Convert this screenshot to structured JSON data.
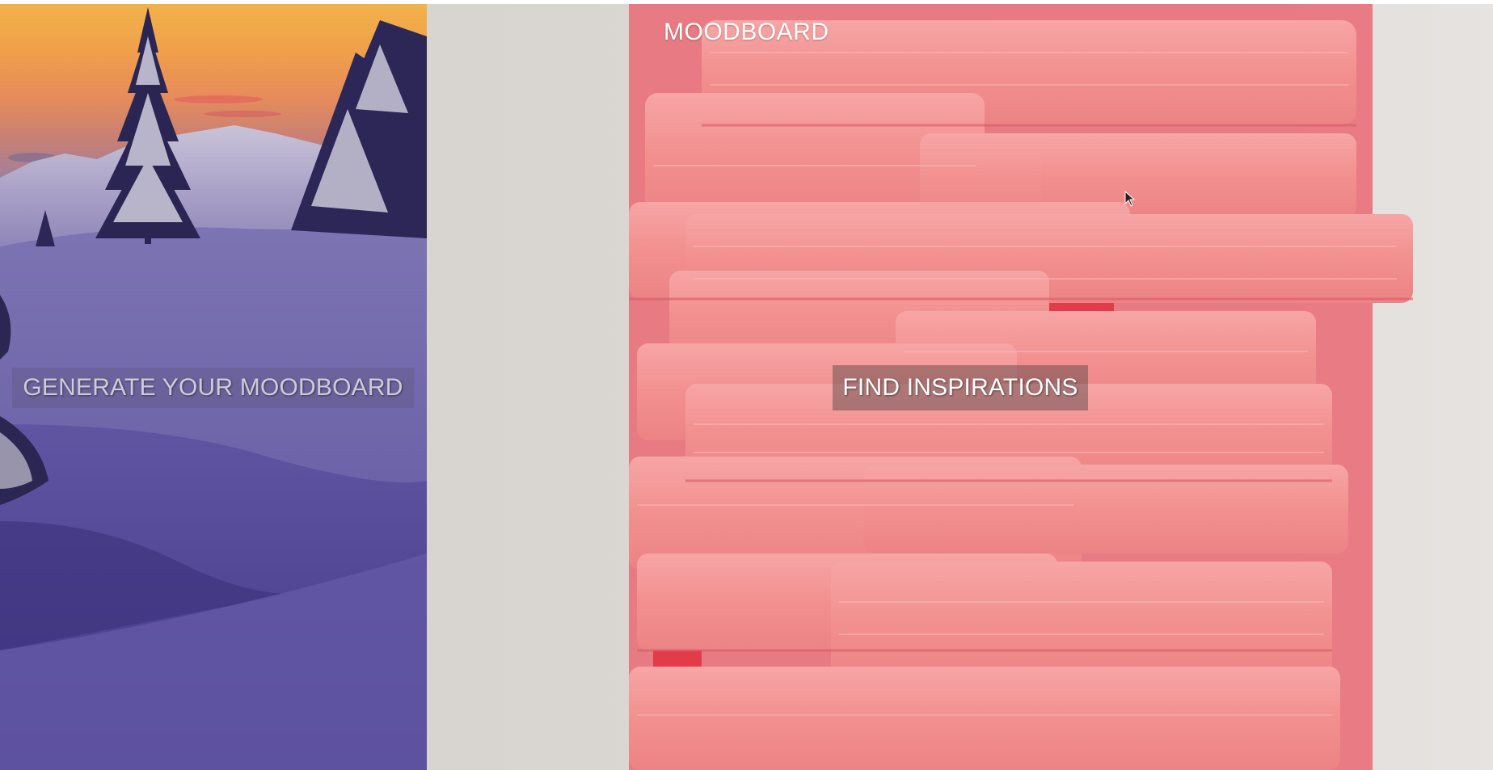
{
  "brand": {
    "title": "MOODBOARD"
  },
  "panels": {
    "left": {
      "cta_label": "GENERATE YOUR MOODBOARD"
    },
    "right": {
      "cta_label": "FIND INSPIRATIONS"
    }
  },
  "colors": {
    "left_sky_top": "#f2b24a",
    "left_snow": "#4f448f",
    "right_background": "#dad6d2",
    "wafer_pink": "#f08a8c",
    "wafer_shadow": "#e0303f",
    "cta_text": "#ffffff"
  },
  "icons": {
    "cursor": "mouse-pointer-icon"
  }
}
